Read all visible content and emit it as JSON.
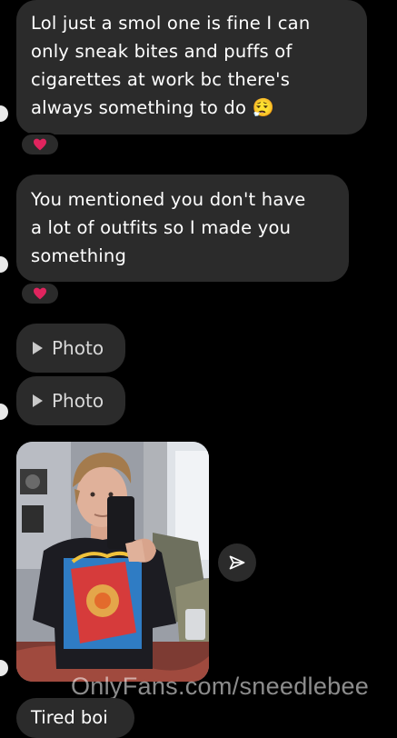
{
  "messages": [
    {
      "text": "Lol just a smol one is fine I can\nonly sneak bites and puffs of\ncigarettes at work bc there's\nalways something to do 😮‍💨",
      "reaction": "heart"
    },
    {
      "text": "You mentioned you don't have\na lot of outfits so I made you\nsomething",
      "reaction": "heart"
    }
  ],
  "attachments": [
    {
      "icon": "play-icon",
      "label": "Photo"
    },
    {
      "icon": "play-icon",
      "label": "Photo"
    }
  ],
  "photo_message": {
    "share_icon": "send-arrow-icon"
  },
  "watermark": "OnlyFans.com/sneedlebee",
  "last_message": {
    "text": "Tired boi"
  },
  "colors": {
    "background": "#000000",
    "bubble": "#2b2b2b",
    "heart": "#e0245e"
  }
}
